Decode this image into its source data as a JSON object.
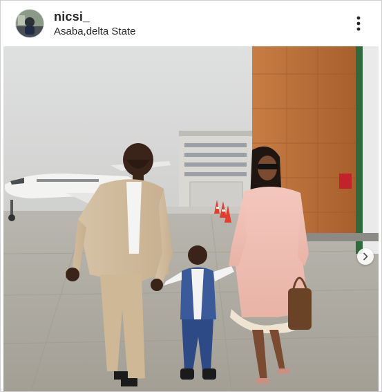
{
  "post": {
    "username": "nicsi_",
    "location": "Asaba,delta State"
  },
  "icons": {
    "more": "vertical-ellipsis-icon",
    "next": "chevron-right-icon"
  },
  "colors": {
    "text": "#262626",
    "header_bg": "#ffffff"
  }
}
